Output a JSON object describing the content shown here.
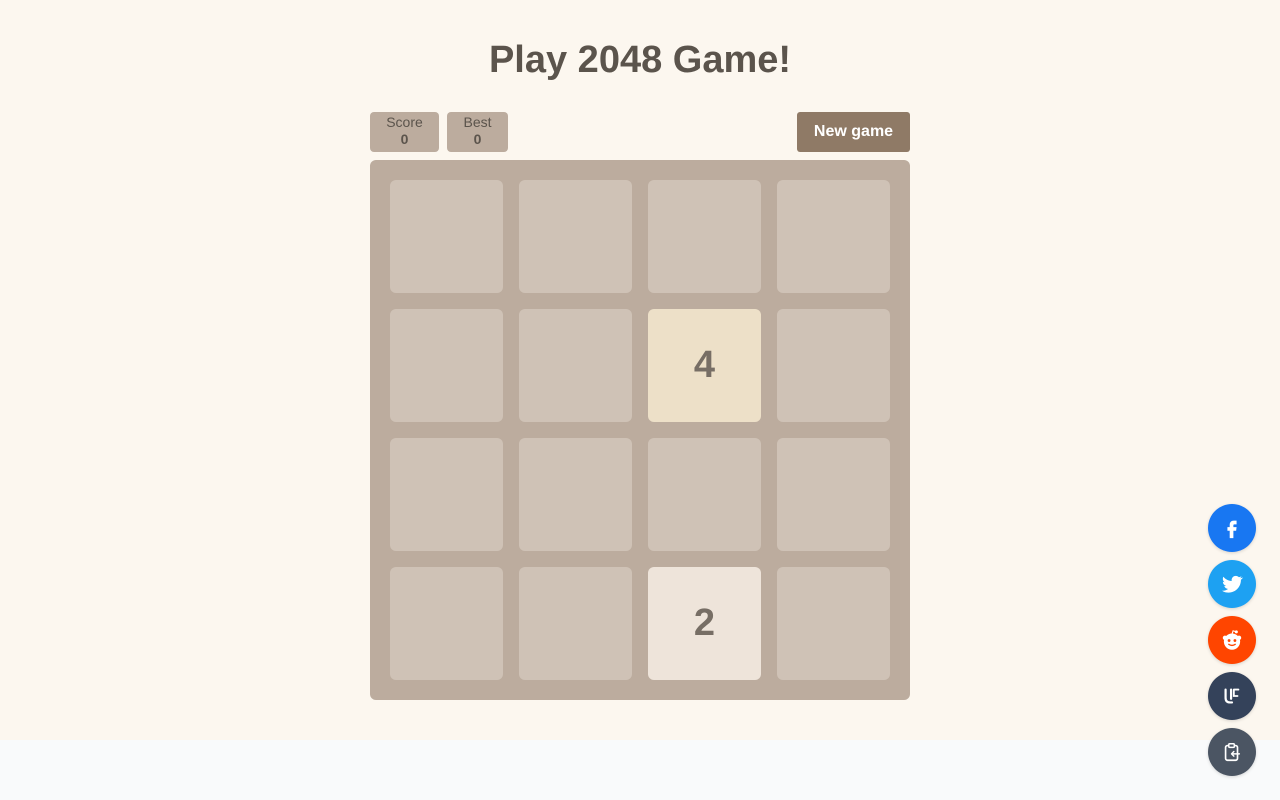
{
  "header": {
    "title": "Play 2048 Game!"
  },
  "scores": {
    "score_label": "Score",
    "score_value": "0",
    "best_label": "Best",
    "best_value": "0"
  },
  "controls": {
    "new_game_label": "New game"
  },
  "board": {
    "size": 4,
    "tiles": [
      [
        null,
        null,
        null,
        null
      ],
      [
        null,
        null,
        "4",
        null
      ],
      [
        null,
        null,
        null,
        null
      ],
      [
        null,
        null,
        "2",
        null
      ]
    ]
  },
  "share": [
    {
      "icon": "facebook-icon",
      "color": "#1877f2"
    },
    {
      "icon": "twitter-icon",
      "color": "#1da1f2"
    },
    {
      "icon": "reddit-icon",
      "color": "#ff4500"
    },
    {
      "icon": "vk-icon",
      "color": "#34425a"
    },
    {
      "icon": "clipboard-icon",
      "color": "#4b5563"
    }
  ],
  "colors": {
    "background": "#fcf7ef",
    "board": "#bcac9e",
    "empty_cell": "#cfc2b6",
    "tile_2": "#eee4da",
    "tile_4": "#ede0c8",
    "button": "#8f7a66",
    "text": "#5b544c"
  }
}
